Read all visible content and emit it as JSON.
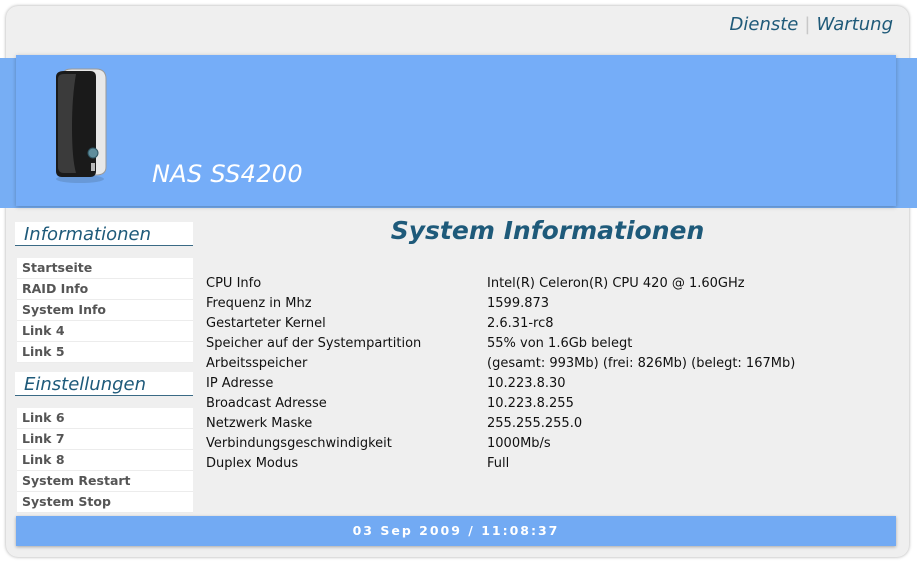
{
  "top_nav": {
    "services": "Dienste",
    "maintenance": "Wartung"
  },
  "banner": {
    "product_name": "NAS SS4200"
  },
  "sidebar": {
    "info_heading": "Informationen",
    "info_items": [
      {
        "label": "Startseite"
      },
      {
        "label": "RAID Info"
      },
      {
        "label": "System Info"
      },
      {
        "label": "Link 4"
      },
      {
        "label": "Link 5"
      }
    ],
    "settings_heading": "Einstellungen",
    "settings_items": [
      {
        "label": "Link 6"
      },
      {
        "label": "Link 7"
      },
      {
        "label": "Link 8"
      },
      {
        "label": "System Restart"
      },
      {
        "label": "System Stop"
      }
    ]
  },
  "main": {
    "title": "System Informationen",
    "rows": [
      {
        "label": "CPU Info",
        "value": "Intel(R) Celeron(R) CPU 420 @ 1.60GHz"
      },
      {
        "label": "Frequenz in Mhz",
        "value": "1599.873"
      },
      {
        "label": "Gestarteter Kernel",
        "value": "2.6.31-rc8"
      },
      {
        "label": "Speicher auf der Systempartition",
        "value": "55% von 1.6Gb belegt"
      },
      {
        "label": "Arbeitsspeicher",
        "value": "(gesamt: 993Mb) (frei: 826Mb) (belegt: 167Mb)"
      },
      {
        "label": "IP Adresse",
        "value": "10.223.8.30"
      },
      {
        "label": "Broadcast Adresse",
        "value": "10.223.8.255"
      },
      {
        "label": "Netzwerk Maske",
        "value": "255.255.255.0"
      },
      {
        "label": "Verbindungsgeschwindigkeit",
        "value": "1000Mb/s"
      },
      {
        "label": "Duplex Modus",
        "value": "Full"
      }
    ]
  },
  "footer": {
    "datetime": "03 Sep 2009 / 11:08:37"
  },
  "colors": {
    "accent": "#75adf8",
    "heading": "#1e5a7a",
    "background": "#efefef"
  }
}
